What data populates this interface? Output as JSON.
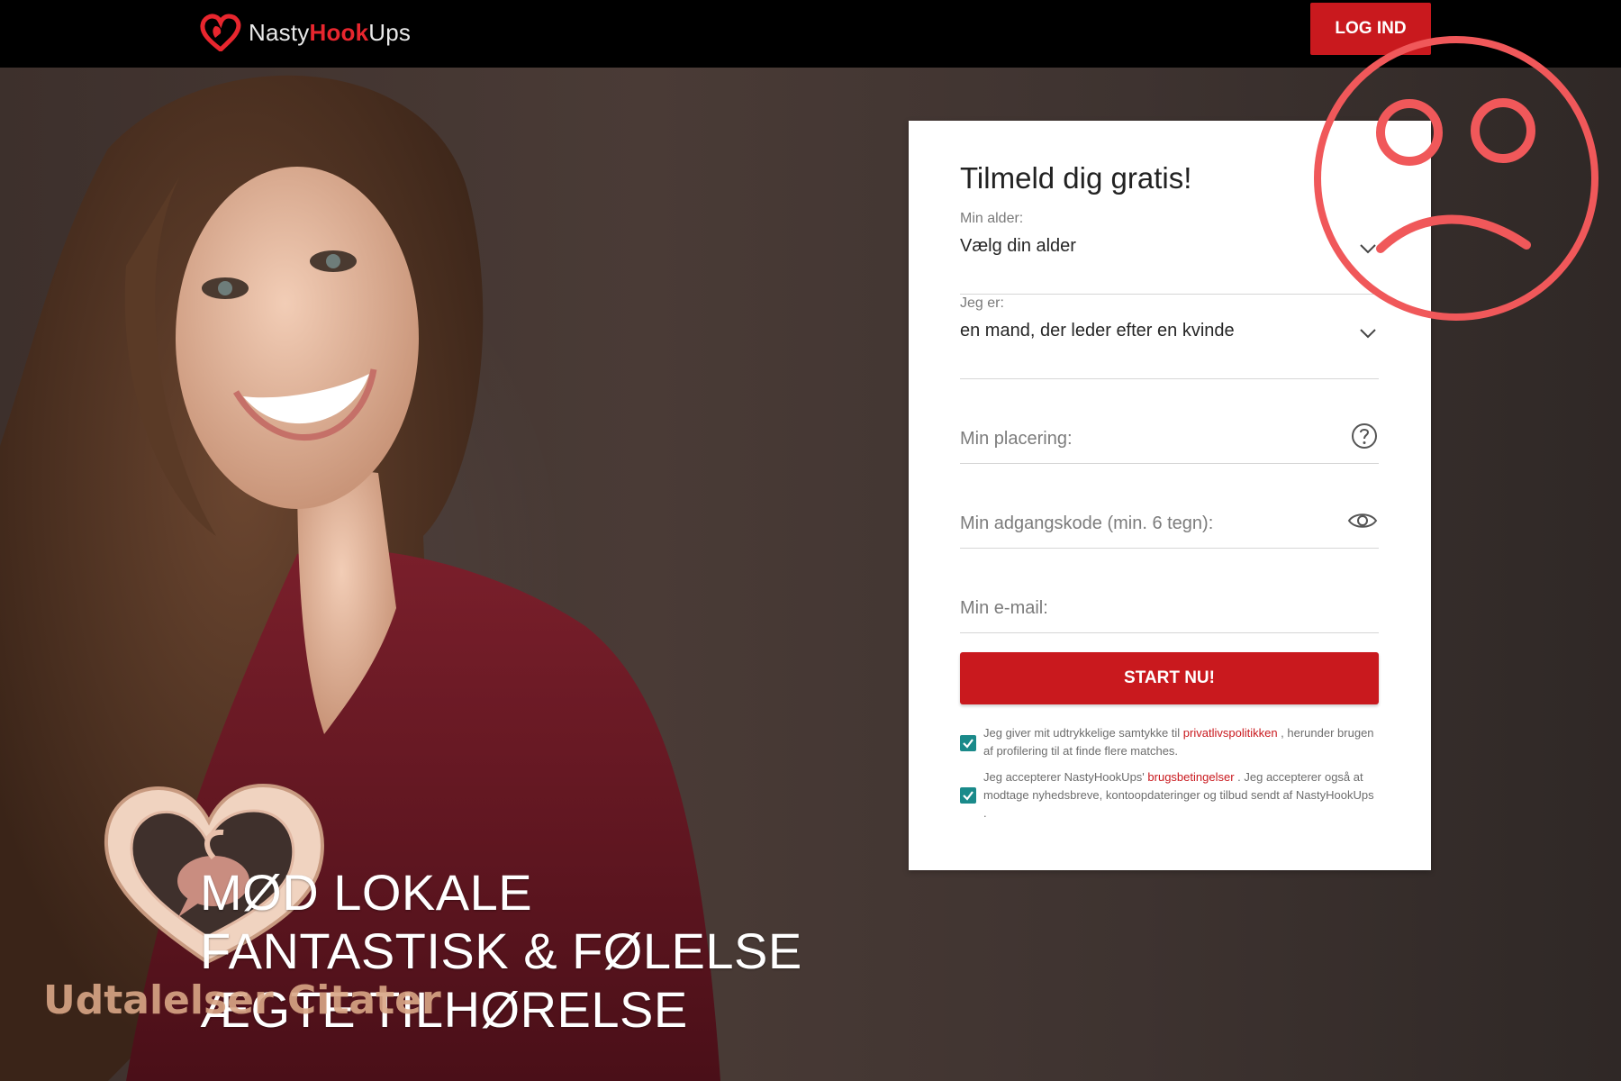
{
  "header": {
    "logo": {
      "part1": "Nasty",
      "part2": "Hook",
      "part3": "Ups"
    },
    "login_label": "LOG IND"
  },
  "form": {
    "title": "Tilmeld dig gratis!",
    "age": {
      "label": "Min alder:",
      "value": "Vælg din alder"
    },
    "gender": {
      "label": "Jeg er:",
      "value": "en mand, der leder efter en kvinde"
    },
    "location": {
      "placeholder": "Min placering:"
    },
    "password": {
      "placeholder": "Min adgangskode (min. 6 tegn):"
    },
    "email": {
      "placeholder": "Min e-mail:"
    },
    "submit_label": "START NU!",
    "consent1": {
      "before": "Jeg giver mit udtrykkelige samtykke til ",
      "link": "privatlivspolitikken",
      "after": " , herunder brugen af profilering til at finde flere matches.",
      "checked": true
    },
    "consent2": {
      "before": "Jeg accepterer NastyHookUps' ",
      "link": "brugsbetingelser",
      "after": " . Jeg accepterer også at modtage nyhedsbreve, kontoopdateringer og tilbud sendt af NastyHookUps .",
      "checked": true
    }
  },
  "hero": {
    "line1": "MØD LOKALE",
    "line2": "FANTASTISK & FØLELSE",
    "line3": "ÆGTE TILHØRELSE"
  },
  "overlay": {
    "watermark": "Udtalelser Citater"
  },
  "icons": {
    "chevron": "chevron-down-icon",
    "help": "question-circle-icon",
    "eye": "eye-icon",
    "sad": "sad-face-icon",
    "heart": "heart-icon"
  },
  "colors": {
    "brand_red": "#c9191e",
    "checkbox": "#1a8a8a",
    "sad_face": "#f0585a",
    "topbar": "#000000"
  }
}
